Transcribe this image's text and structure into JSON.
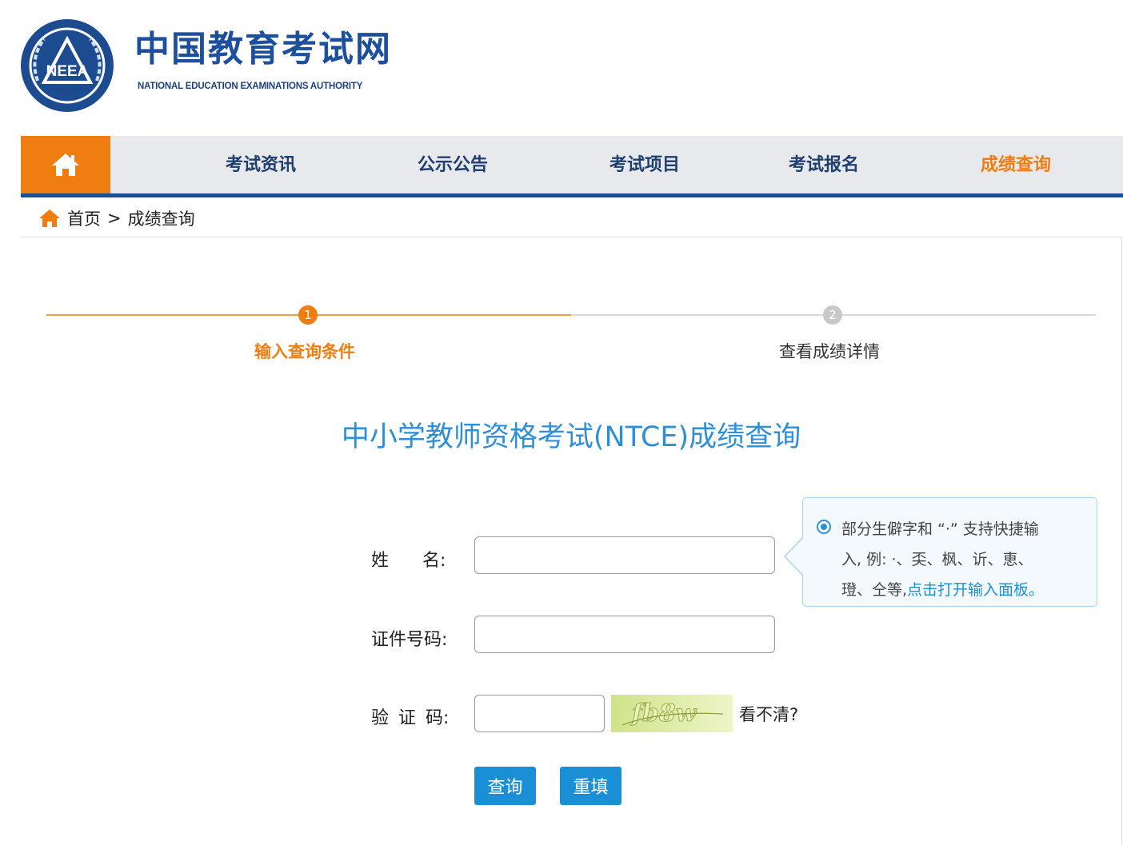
{
  "header": {
    "logo_text": "NEEA",
    "title": "中国教育考试网",
    "subtitle": "NATIONAL EDUCATION EXAMINATIONS AUTHORITY"
  },
  "nav": {
    "home_icon": "home-icon",
    "items": [
      {
        "label": "考试资讯",
        "active": false
      },
      {
        "label": "公示公告",
        "active": false
      },
      {
        "label": "考试项目",
        "active": false
      },
      {
        "label": "考试报名",
        "active": false
      },
      {
        "label": "成绩查询",
        "active": true
      }
    ]
  },
  "breadcrumb": {
    "home": "首页",
    "separator": ">",
    "current": "成绩查询"
  },
  "steps": [
    {
      "number": "1",
      "label": "输入查询条件",
      "active": true
    },
    {
      "number": "2",
      "label": "查看成绩详情",
      "active": false
    }
  ],
  "page_title": "中小学教师资格考试(NTCE)成绩查询",
  "form": {
    "name_label_a": "姓",
    "name_label_b": "名:",
    "name_value": "",
    "id_label": "证件号码:",
    "id_value": "",
    "captcha_label_a": "验",
    "captcha_label_b": "证",
    "captcha_label_c": "码:",
    "captcha_value": "",
    "captcha_image_text": "fb8w",
    "refresh_label": "看不清?",
    "submit_label": "查询",
    "reset_label": "重填"
  },
  "tip": {
    "line1": "部分生僻字和 “·” 支持快捷输",
    "line2": "入, 例: ·、奀、枫、䜣、恵、",
    "line3_prefix": "璒、仝等,",
    "link": "点击打开输入面板。"
  },
  "colors": {
    "brand_blue": "#1e4f9c",
    "accent_orange": "#f07d10",
    "title_blue": "#2e8ed8",
    "button_blue": "#1a8fd6"
  }
}
